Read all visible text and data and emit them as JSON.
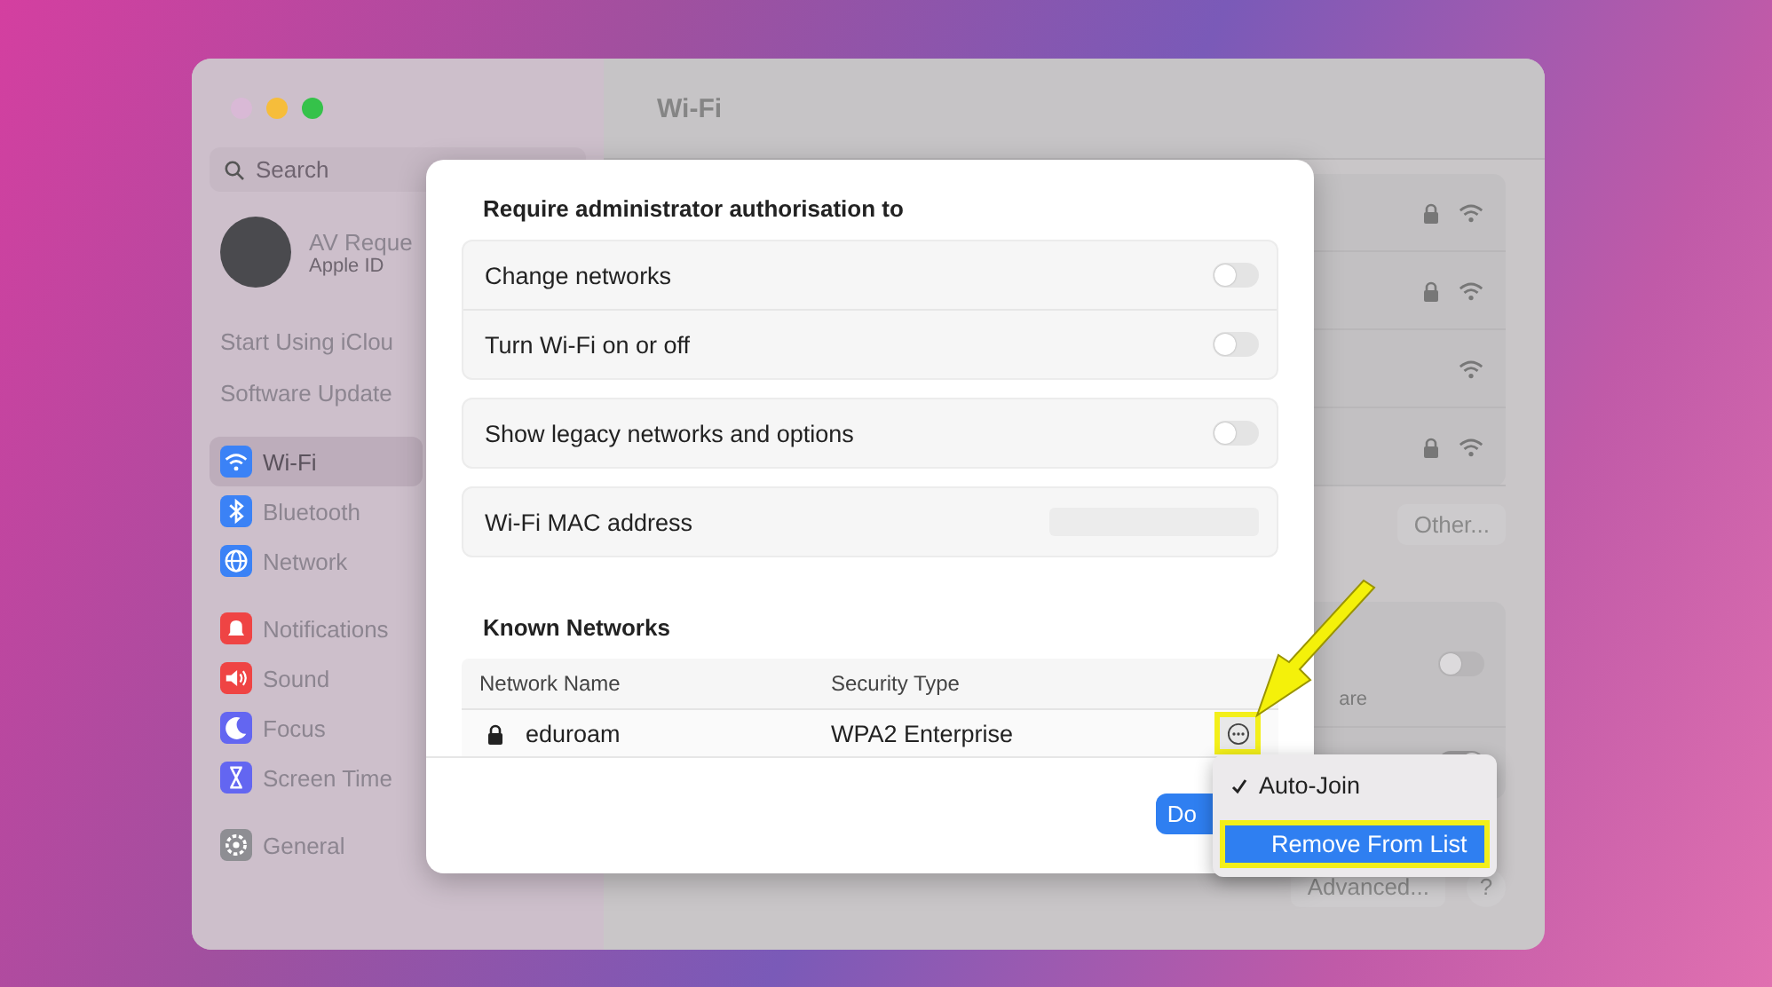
{
  "window": {
    "title": "Wi-Fi"
  },
  "sidebar": {
    "search": {
      "placeholder": "Search"
    },
    "account": {
      "name": "AV Reque",
      "subtitle": "Apple ID"
    },
    "links": [
      "Start Using iClou",
      "Software Update"
    ],
    "groups": [
      [
        {
          "label": "Wi-Fi",
          "kind": "wifi",
          "color": "#3b82f6",
          "selected": true
        },
        {
          "label": "Bluetooth",
          "kind": "bluetooth",
          "color": "#3b82f6",
          "selected": false
        },
        {
          "label": "Network",
          "kind": "network",
          "color": "#3b82f6",
          "selected": false
        }
      ],
      [
        {
          "label": "Notifications",
          "kind": "bell",
          "color": "#ef4444",
          "selected": false
        },
        {
          "label": "Sound",
          "kind": "sound",
          "color": "#ef4444",
          "selected": false
        },
        {
          "label": "Focus",
          "kind": "moon",
          "color": "#6366f1",
          "selected": false
        },
        {
          "label": "Screen Time",
          "kind": "hourglass",
          "color": "#6366f1",
          "selected": false
        }
      ],
      [
        {
          "label": "General",
          "kind": "gear",
          "color": "#8e8e93",
          "selected": false
        }
      ]
    ]
  },
  "networks": [
    {
      "locked": true
    },
    {
      "locked": true
    },
    {
      "locked": false
    },
    {
      "locked": true
    }
  ],
  "other_button": "Other...",
  "partial_row": {
    "text": "are",
    "on": false
  },
  "second_toggle": {
    "on": true
  },
  "advanced_button": "Advanced...",
  "help_button": "?",
  "sheet": {
    "title": "Require administrator authorisation to",
    "groups": [
      [
        {
          "label": "Change networks",
          "kind": "toggle",
          "on": false
        },
        {
          "label": "Turn Wi-Fi on or off",
          "kind": "toggle",
          "on": false
        }
      ],
      [
        {
          "label": "Show legacy networks and options",
          "kind": "toggle",
          "on": false
        }
      ],
      [
        {
          "label": "Wi-Fi MAC address",
          "kind": "hidden-value"
        }
      ]
    ],
    "known_title": "Known Networks",
    "columns": [
      "Network Name",
      "Security Type"
    ],
    "rows": [
      {
        "name": "eduroam",
        "security": "WPA2 Enterprise",
        "locked": true
      }
    ],
    "done_button": "Do"
  },
  "menu": [
    {
      "label": "Auto-Join",
      "checked": true,
      "selected": false
    },
    {
      "label": "Remove From List",
      "checked": false,
      "selected": true
    }
  ]
}
